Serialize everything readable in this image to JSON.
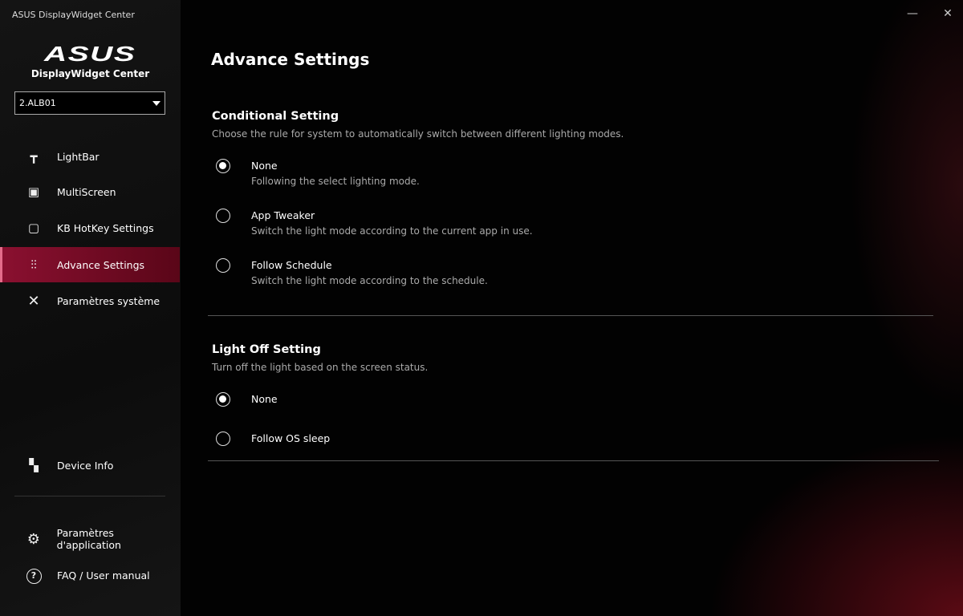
{
  "window": {
    "title": "ASUS DisplayWidget Center",
    "minimize": "—",
    "close": "✕"
  },
  "sidebar": {
    "logo": "ASUS",
    "app_name": "DisplayWidget Center",
    "device_select": "2.ALB01",
    "items": [
      {
        "label": "LightBar",
        "icon": "lightbar-icon"
      },
      {
        "label": "MultiScreen",
        "icon": "monitor-icon"
      },
      {
        "label": "KB HotKey Settings",
        "icon": "keyboard-icon"
      },
      {
        "label": "Advance Settings",
        "icon": "sliders-icon",
        "active": true
      },
      {
        "label": "Paramètres système",
        "icon": "tools-icon"
      }
    ],
    "bottom": [
      {
        "label": "Device Info",
        "icon": "device-info-icon"
      },
      {
        "label": "Paramètres d'application",
        "icon": "gear-icon"
      },
      {
        "label": "FAQ / User manual",
        "icon": "help-icon"
      }
    ],
    "accent": "#8a1030"
  },
  "main": {
    "title": "Advance Settings",
    "conditional": {
      "title": "Conditional Setting",
      "desc": "Choose the rule for system to automatically switch between different lighting modes.",
      "options": [
        {
          "label": "None",
          "desc": "Following the select lighting mode.",
          "selected": true
        },
        {
          "label": "App Tweaker",
          "desc": "Switch the light mode according to the current app in use.",
          "selected": false
        },
        {
          "label": "Follow Schedule",
          "desc": "Switch the light mode according to the schedule.",
          "selected": false
        }
      ]
    },
    "lightoff": {
      "title": "Light Off Setting",
      "desc": "Turn off the light based on the screen status.",
      "options": [
        {
          "label": "None",
          "selected": true
        },
        {
          "label": "Follow OS sleep",
          "selected": false
        }
      ]
    }
  }
}
